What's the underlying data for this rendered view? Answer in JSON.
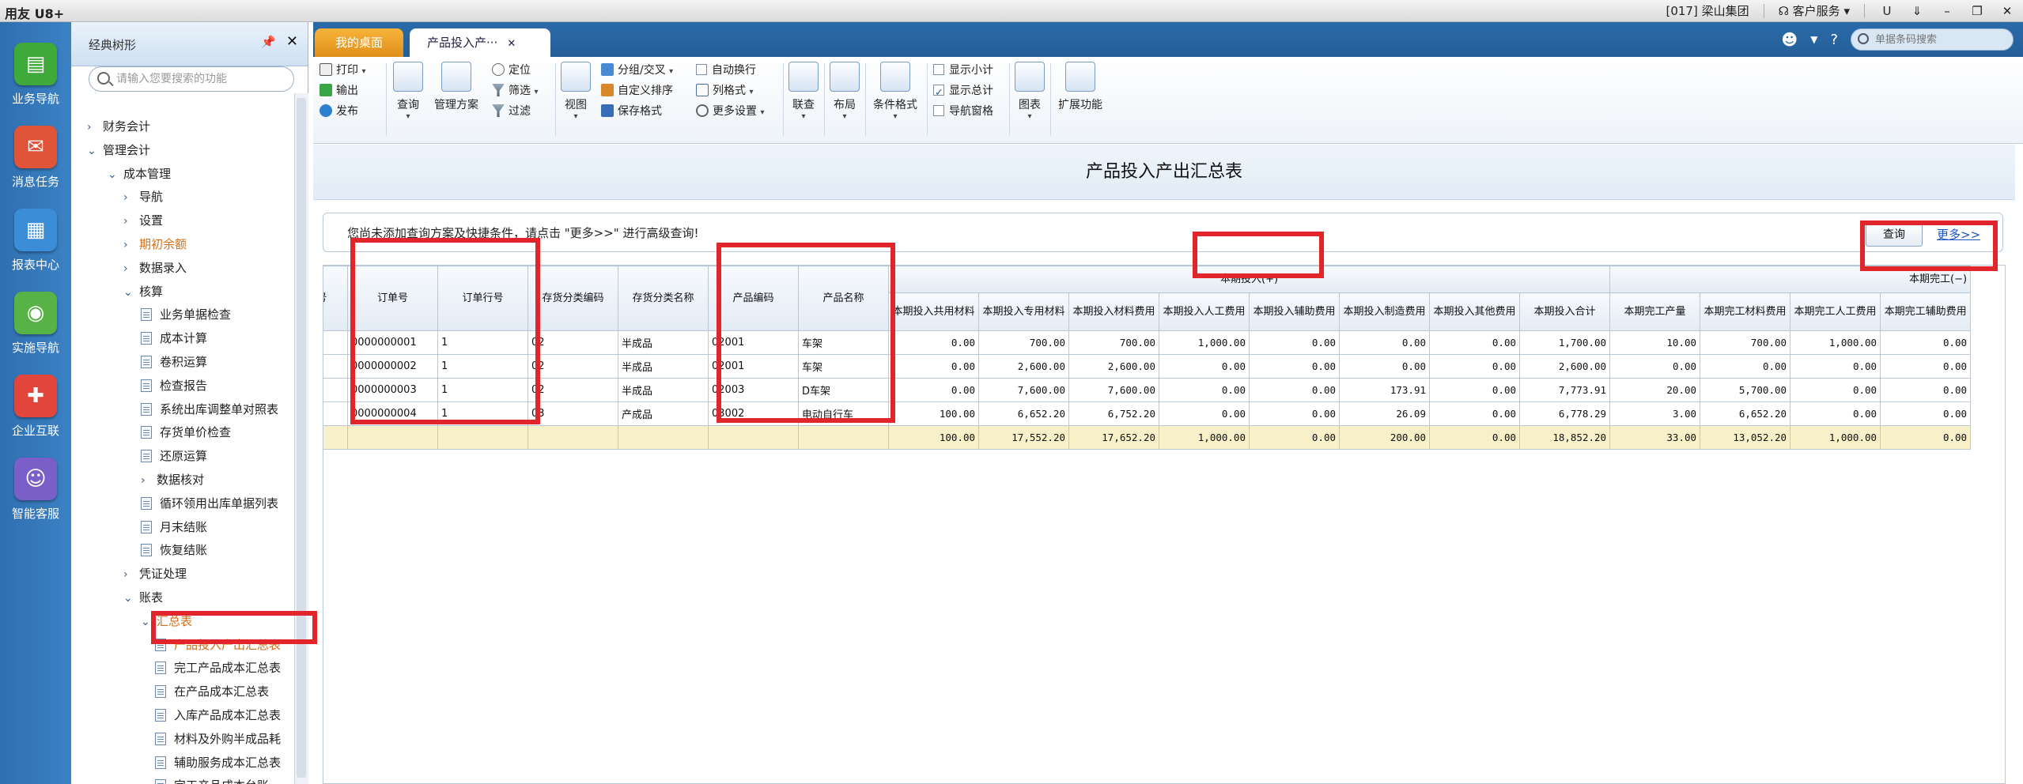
{
  "titlebar": {
    "logo": "用友 U8+",
    "company": "[017] 梁山集团",
    "service": "客户服务",
    "u_icon": "U"
  },
  "leftnav": [
    {
      "label": "业务导航",
      "color": "#3fa93a",
      "glyph": "▤"
    },
    {
      "label": "消息任务",
      "color": "#e0543a",
      "glyph": "✉"
    },
    {
      "label": "报表中心",
      "color": "#3b8dd8",
      "glyph": "▦"
    },
    {
      "label": "实施导航",
      "color": "#57b346",
      "glyph": "◉"
    },
    {
      "label": "企业互联",
      "color": "#e2453b",
      "glyph": "✚"
    },
    {
      "label": "智能客服",
      "color": "#7b5fc9",
      "glyph": "☺"
    }
  ],
  "tree": {
    "title": "经典树形",
    "search_placeholder": "请输入您要搜索的功能",
    "nodes": [
      {
        "label": "财务会计",
        "arrow": "›",
        "indent": 0
      },
      {
        "label": "管理会计",
        "arrow": "⌄",
        "indent": 0
      },
      {
        "label": "成本管理",
        "arrow": "⌄",
        "indent": 1
      },
      {
        "label": "导航",
        "arrow": "›",
        "indent": 2
      },
      {
        "label": "设置",
        "arrow": "›",
        "indent": 2
      },
      {
        "label": "期初余额",
        "arrow": "›",
        "indent": 2,
        "orange": true
      },
      {
        "label": "数据录入",
        "arrow": "›",
        "indent": 2
      },
      {
        "label": "核算",
        "arrow": "⌄",
        "indent": 2
      },
      {
        "label": "业务单据检查",
        "doc": true,
        "indent": 3
      },
      {
        "label": "成本计算",
        "doc": true,
        "indent": 3
      },
      {
        "label": "卷积运算",
        "doc": true,
        "indent": 3
      },
      {
        "label": "检查报告",
        "doc": true,
        "indent": 3
      },
      {
        "label": "系统出库调整单对照表",
        "doc": true,
        "indent": 3
      },
      {
        "label": "存货单价检查",
        "doc": true,
        "indent": 3
      },
      {
        "label": "还原运算",
        "doc": true,
        "indent": 3
      },
      {
        "label": "数据核对",
        "arrow": "›",
        "indent": 3
      },
      {
        "label": "循环领用出库单据列表",
        "doc": true,
        "indent": 3
      },
      {
        "label": "月末结账",
        "doc": true,
        "indent": 3
      },
      {
        "label": "恢复结账",
        "doc": true,
        "indent": 3
      },
      {
        "label": "凭证处理",
        "arrow": "›",
        "indent": 2
      },
      {
        "label": "账表",
        "arrow": "⌄",
        "indent": 2
      },
      {
        "label": "汇总表",
        "arrow": "⌄",
        "indent": 3,
        "orange": true
      },
      {
        "label": "产品投入产出汇总表",
        "doc": true,
        "indent": 4,
        "selected": true
      },
      {
        "label": "完工产品成本汇总表",
        "doc": true,
        "indent": 4
      },
      {
        "label": "在产品成本汇总表",
        "doc": true,
        "indent": 4
      },
      {
        "label": "入库产品成本汇总表",
        "doc": true,
        "indent": 4
      },
      {
        "label": "材料及外购半成品耗",
        "doc": true,
        "indent": 4
      },
      {
        "label": "辅助服务成本汇总表",
        "doc": true,
        "indent": 4
      },
      {
        "label": "完工产品成本台账",
        "doc": true,
        "indent": 4
      }
    ]
  },
  "tabs": {
    "home": "我的桌面",
    "active": "产品投入产···"
  },
  "toolbar": {
    "print": "打印",
    "export": "输出",
    "publish": "发布",
    "query": "查询",
    "manage_scheme": "管理方案",
    "locate": "定位",
    "filter": "筛选",
    "filter2": "过滤",
    "view": "视图",
    "group": "分组/交叉",
    "custom_sort": "自定义排序",
    "save_format": "保存格式",
    "auto_wrap": "自动换行",
    "col_format": "列格式",
    "more_settings": "更多设置",
    "link": "联查",
    "layout": "布局",
    "cond_format": "条件格式",
    "show_subtotal": "显示小计",
    "show_total": "显示总计",
    "nav_pane": "导航窗格",
    "chart": "图表",
    "extend": "扩展功能",
    "search_placeholder": "单据条码搜索"
  },
  "report": {
    "title": "产品投入产出汇总表",
    "hint": "您尚未添加查询方案及快捷条件，请点击 \"更多>>\" 进行高级查询!",
    "query_button": "查询",
    "more_link": "更多>>",
    "group_invest": "本期投入(+)",
    "group_complete": "本期完工(−)",
    "columns": [
      "汇号",
      "订单号",
      "订单行号",
      "存货分类编码",
      "存货分类名称",
      "产品编码",
      "产品名称",
      "本期投入共用材料",
      "本期投入专用材料",
      "本期投入材料费用",
      "本期投入人工费用",
      "本期投入辅助费用",
      "本期投入制造费用",
      "本期投入其他费用",
      "本期投入合计",
      "本期完工产量",
      "本期完工材料费用",
      "本期完工人工费用",
      "本期完工辅助费用"
    ],
    "rows": [
      [
        "",
        "0000000001",
        "1",
        "02",
        "半成品",
        "02001",
        "车架",
        "0.00",
        "700.00",
        "700.00",
        "1,000.00",
        "0.00",
        "0.00",
        "0.00",
        "1,700.00",
        "10.00",
        "700.00",
        "1,000.00",
        "0.00"
      ],
      [
        "",
        "0000000002",
        "1",
        "02",
        "半成品",
        "02001",
        "车架",
        "0.00",
        "2,600.00",
        "2,600.00",
        "0.00",
        "0.00",
        "0.00",
        "0.00",
        "2,600.00",
        "0.00",
        "0.00",
        "0.00",
        "0.00"
      ],
      [
        "",
        "0000000003",
        "1",
        "02",
        "半成品",
        "02003",
        "D车架",
        "0.00",
        "7,600.00",
        "7,600.00",
        "0.00",
        "0.00",
        "173.91",
        "0.00",
        "7,773.91",
        "20.00",
        "5,700.00",
        "0.00",
        "0.00"
      ],
      [
        "",
        "0000000004",
        "1",
        "03",
        "产成品",
        "03002",
        "电动自行车",
        "100.00",
        "6,652.20",
        "6,752.20",
        "0.00",
        "0.00",
        "26.09",
        "0.00",
        "6,778.29",
        "3.00",
        "6,652.20",
        "0.00",
        "0.00"
      ]
    ],
    "total": [
      "",
      "",
      "",
      "",
      "",
      "",
      "",
      "100.00",
      "17,552.20",
      "17,652.20",
      "1,000.00",
      "0.00",
      "200.00",
      "0.00",
      "18,852.20",
      "33.00",
      "13,052.20",
      "1,000.00",
      "0.00"
    ]
  }
}
